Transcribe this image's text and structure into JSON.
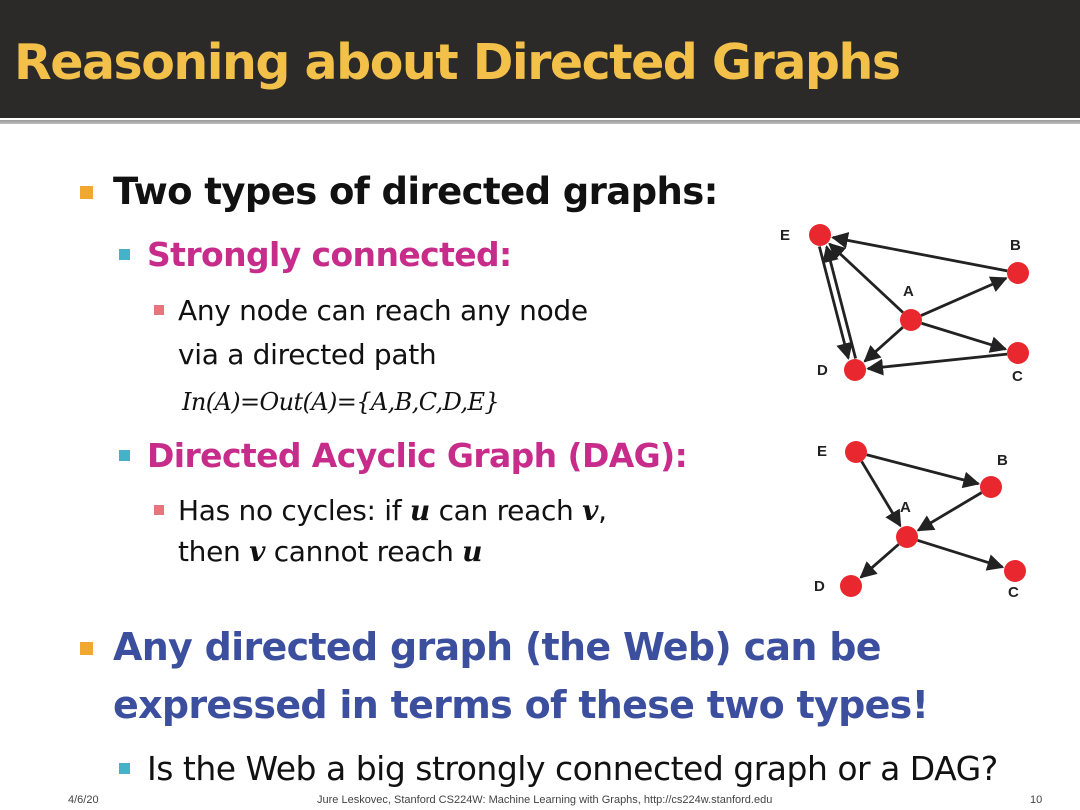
{
  "title": "Reasoning about Directed Graphs",
  "bullets": {
    "main1": "Two types of directed graphs:",
    "strong": {
      "label": "Strongly connected:",
      "desc_line1": "Any node can reach any node",
      "desc_line2": "via a directed path",
      "formula": "In(A)=Out(A)={A,B,C,D,E}"
    },
    "dag": {
      "label": "Directed Acyclic Graph (DAG):",
      "l1_a": "Has no cycles: if ",
      "l1_u": "u",
      "l1_b": " can reach ",
      "l1_v": "v",
      "l1_c": ",",
      "l2_a": "then ",
      "l2_v": "v",
      "l2_b": " cannot reach ",
      "l2_u": "u"
    },
    "main2_line1": "Any directed graph (the Web) can be",
    "main2_line2": "expressed in terms of these two types!",
    "question": "Is the Web a big strongly connected graph or a DAG?"
  },
  "graphs": {
    "strongly_connected": {
      "nodes": [
        "E",
        "B",
        "A",
        "D",
        "C"
      ],
      "edges": [
        [
          "A",
          "E"
        ],
        [
          "E",
          "D"
        ],
        [
          "D",
          "E"
        ],
        [
          "B",
          "E"
        ],
        [
          "A",
          "B"
        ],
        [
          "A",
          "D"
        ],
        [
          "A",
          "C"
        ],
        [
          "C",
          "D"
        ]
      ]
    },
    "dag": {
      "nodes": [
        "E",
        "B",
        "A",
        "D",
        "C"
      ],
      "edges": [
        [
          "E",
          "B"
        ],
        [
          "E",
          "A"
        ],
        [
          "B",
          "A"
        ],
        [
          "A",
          "D"
        ],
        [
          "A",
          "C"
        ]
      ]
    }
  },
  "footer": {
    "date": "4/6/20",
    "credit": "Jure Leskovec, Stanford CS224W: Machine Learning with Graphs, http://cs224w.stanford.edu",
    "page": "10"
  },
  "colors": {
    "title": "#f3c14a",
    "title_bar": "#2b2a29",
    "accent_magenta": "#c72c8b",
    "accent_blue": "#3b4f9e",
    "node": "#e8282e"
  }
}
